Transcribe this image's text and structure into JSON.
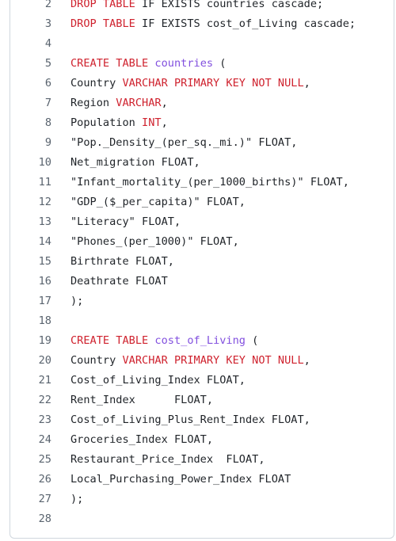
{
  "colors": {
    "keyword": "#cf222e",
    "entity": "#8250df",
    "plain": "#1f2328",
    "line_number": "#59636e",
    "border": "#d0d7de"
  },
  "code": {
    "lines": [
      {
        "num": "2",
        "tokens": [
          {
            "t": "DROP TABLE",
            "k": "kw"
          },
          {
            "t": " IF EXISTS countries cascade;",
            "k": "plain"
          }
        ]
      },
      {
        "num": "3",
        "tokens": [
          {
            "t": "DROP TABLE",
            "k": "kw"
          },
          {
            "t": " IF EXISTS cost_of_Living cascade;",
            "k": "plain"
          }
        ]
      },
      {
        "num": "4",
        "tokens": []
      },
      {
        "num": "5",
        "tokens": [
          {
            "t": "CREATE TABLE",
            "k": "kw"
          },
          {
            "t": " ",
            "k": "plain"
          },
          {
            "t": "countries",
            "k": "ent"
          },
          {
            "t": " (",
            "k": "plain"
          }
        ]
      },
      {
        "num": "6",
        "tokens": [
          {
            "t": "Country ",
            "k": "plain"
          },
          {
            "t": "VARCHAR PRIMARY KEY NOT NULL",
            "k": "kw"
          },
          {
            "t": ",",
            "k": "plain"
          }
        ]
      },
      {
        "num": "7",
        "tokens": [
          {
            "t": "Region ",
            "k": "plain"
          },
          {
            "t": "VARCHAR",
            "k": "kw"
          },
          {
            "t": ",",
            "k": "plain"
          }
        ]
      },
      {
        "num": "8",
        "tokens": [
          {
            "t": "Population ",
            "k": "plain"
          },
          {
            "t": "INT",
            "k": "kw"
          },
          {
            "t": ",",
            "k": "plain"
          }
        ]
      },
      {
        "num": "9",
        "tokens": [
          {
            "t": "\"Pop._Density_(per_sq._mi.)\"",
            "k": "str"
          },
          {
            "t": " FLOAT,",
            "k": "plain"
          }
        ]
      },
      {
        "num": "10",
        "tokens": [
          {
            "t": "Net_migration FLOAT,",
            "k": "plain"
          }
        ]
      },
      {
        "num": "11",
        "tokens": [
          {
            "t": "\"Infant_mortality_(per_1000_births)\"",
            "k": "str"
          },
          {
            "t": " FLOAT,",
            "k": "plain"
          }
        ]
      },
      {
        "num": "12",
        "tokens": [
          {
            "t": "\"GDP_($_per_capita)\"",
            "k": "str"
          },
          {
            "t": " FLOAT,",
            "k": "plain"
          }
        ]
      },
      {
        "num": "13",
        "tokens": [
          {
            "t": "\"Literacy\"",
            "k": "str"
          },
          {
            "t": " FLOAT,",
            "k": "plain"
          }
        ]
      },
      {
        "num": "14",
        "tokens": [
          {
            "t": "\"Phones_(per_1000)\"",
            "k": "str"
          },
          {
            "t": " FLOAT,",
            "k": "plain"
          }
        ]
      },
      {
        "num": "15",
        "tokens": [
          {
            "t": "Birthrate FLOAT,",
            "k": "plain"
          }
        ]
      },
      {
        "num": "16",
        "tokens": [
          {
            "t": "Deathrate FLOAT",
            "k": "plain"
          }
        ]
      },
      {
        "num": "17",
        "tokens": [
          {
            "t": ");",
            "k": "plain"
          }
        ]
      },
      {
        "num": "18",
        "tokens": []
      },
      {
        "num": "19",
        "tokens": [
          {
            "t": "CREATE TABLE",
            "k": "kw"
          },
          {
            "t": " ",
            "k": "plain"
          },
          {
            "t": "cost_of_Living",
            "k": "ent"
          },
          {
            "t": " (",
            "k": "plain"
          }
        ]
      },
      {
        "num": "20",
        "tokens": [
          {
            "t": "Country ",
            "k": "plain"
          },
          {
            "t": "VARCHAR PRIMARY KEY NOT NULL",
            "k": "kw"
          },
          {
            "t": ",",
            "k": "plain"
          }
        ]
      },
      {
        "num": "21",
        "tokens": [
          {
            "t": "Cost_of_Living_Index FLOAT,",
            "k": "plain"
          }
        ]
      },
      {
        "num": "22",
        "tokens": [
          {
            "t": "Rent_Index      FLOAT,",
            "k": "plain"
          }
        ]
      },
      {
        "num": "23",
        "tokens": [
          {
            "t": "Cost_of_Living_Plus_Rent_Index FLOAT,",
            "k": "plain"
          }
        ]
      },
      {
        "num": "24",
        "tokens": [
          {
            "t": "Groceries_Index FLOAT,",
            "k": "plain"
          }
        ]
      },
      {
        "num": "25",
        "tokens": [
          {
            "t": "Restaurant_Price_Index  FLOAT,",
            "k": "plain"
          }
        ]
      },
      {
        "num": "26",
        "tokens": [
          {
            "t": "Local_Purchasing_Power_Index FLOAT",
            "k": "plain"
          }
        ]
      },
      {
        "num": "27",
        "tokens": [
          {
            "t": ");",
            "k": "plain"
          }
        ]
      },
      {
        "num": "28",
        "tokens": []
      }
    ]
  }
}
